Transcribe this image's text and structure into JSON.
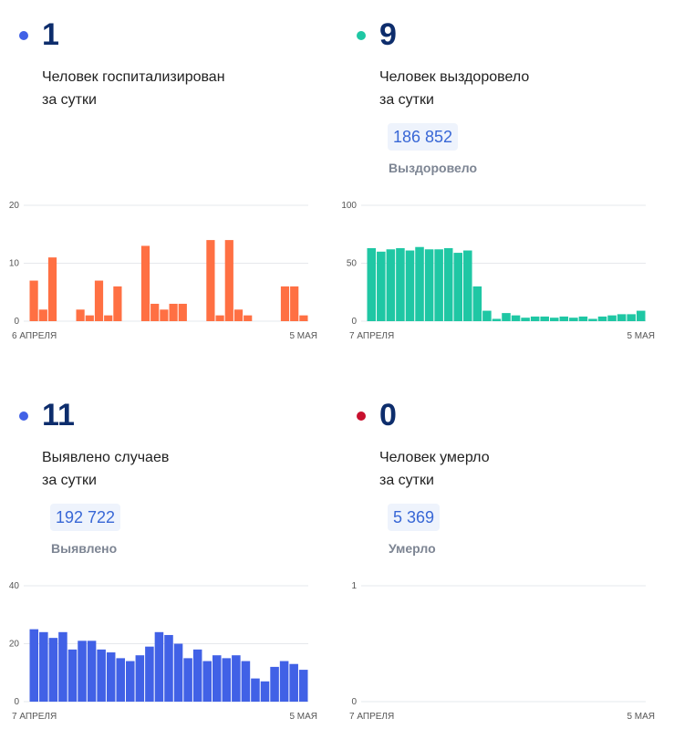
{
  "panels": [
    {
      "value": "1",
      "line1": "Человек госпитализирован",
      "line2": "за сутки",
      "total": "",
      "total_label": "",
      "color": "#4161e6"
    },
    {
      "value": "9",
      "line1": "Человек выздоровело",
      "line2": "за сутки",
      "total": "186 852",
      "total_label": "Выздоровело",
      "color": "#1fc7a4"
    },
    {
      "value": "11",
      "line1": "Выявлено случаев",
      "line2": "за сутки",
      "total": "192 722",
      "total_label": "Выявлено",
      "color": "#4161e6"
    },
    {
      "value": "0",
      "line1": "Человек умерло",
      "line2": "за сутки",
      "total": "5 369",
      "total_label": "Умерло",
      "color": "#c8102e"
    }
  ],
  "chart_data": [
    {
      "type": "bar",
      "bar_color": "#ff7043",
      "ylim": [
        0,
        20
      ],
      "yticks": [
        "20",
        "10",
        "0"
      ],
      "x_start_label": "6 АПРЕЛЯ",
      "x_end_label": "5 МАЯ",
      "values": [
        7,
        2,
        11,
        0,
        0,
        2,
        1,
        7,
        1,
        6,
        0,
        0,
        13,
        3,
        2,
        3,
        3,
        0,
        0,
        14,
        1,
        14,
        2,
        1,
        0,
        0,
        0,
        6,
        6,
        1
      ]
    },
    {
      "type": "bar",
      "bar_color": "#1fc7a4",
      "ylim": [
        0,
        100
      ],
      "yticks": [
        "100",
        "50",
        "0"
      ],
      "x_start_label": "7 АПРЕЛЯ",
      "x_end_label": "5 МАЯ",
      "values": [
        63,
        60,
        62,
        63,
        61,
        64,
        62,
        62,
        63,
        59,
        61,
        30,
        9,
        2,
        7,
        5,
        3,
        4,
        4,
        3,
        4,
        3,
        4,
        2,
        4,
        5,
        6,
        6,
        9
      ]
    },
    {
      "type": "bar",
      "bar_color": "#4161e6",
      "ylim": [
        0,
        40
      ],
      "yticks": [
        "40",
        "20",
        "0"
      ],
      "x_start_label": "7 АПРЕЛЯ",
      "x_end_label": "5 МАЯ",
      "values": [
        25,
        24,
        22,
        24,
        18,
        21,
        21,
        18,
        17,
        15,
        14,
        16,
        19,
        24,
        23,
        20,
        15,
        18,
        14,
        16,
        15,
        16,
        14,
        8,
        7,
        12,
        14,
        13,
        11
      ]
    },
    {
      "type": "bar",
      "bar_color": "#c8102e",
      "ylim": [
        0,
        1
      ],
      "yticks": [
        "1",
        "0"
      ],
      "x_start_label": "7 АПРЕЛЯ",
      "x_end_label": "5 МАЯ",
      "values": [
        0,
        0,
        0,
        0,
        0,
        0,
        0,
        0,
        0,
        0,
        0,
        0,
        0,
        0,
        0,
        0,
        0,
        0,
        0,
        0,
        0,
        0,
        0,
        0,
        0,
        0,
        0,
        0,
        0
      ]
    }
  ]
}
